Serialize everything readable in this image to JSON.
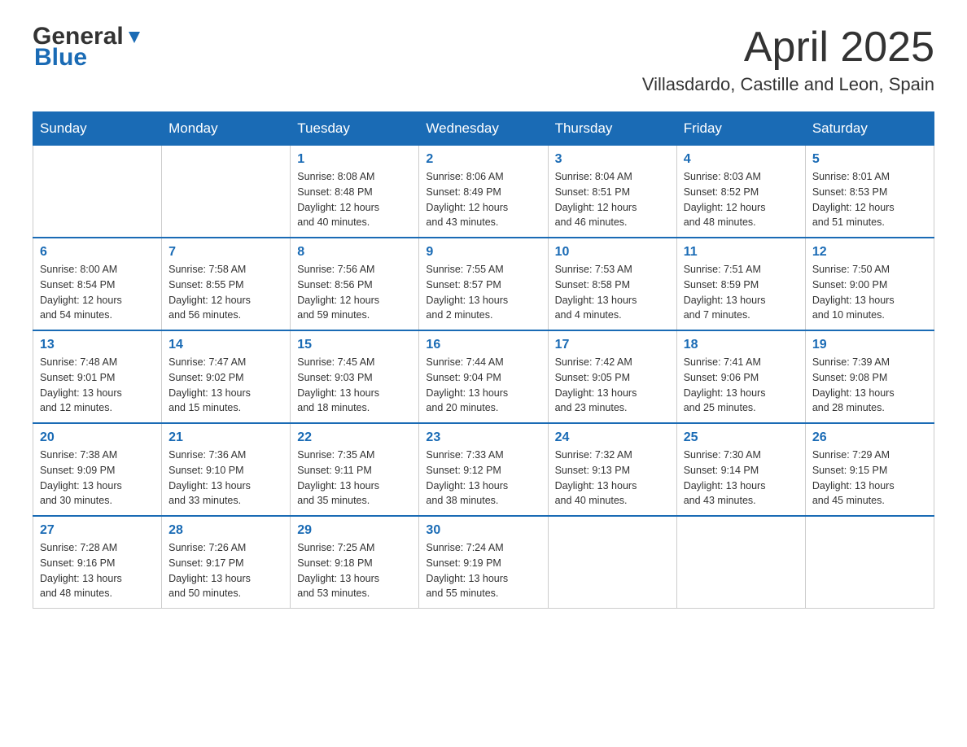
{
  "header": {
    "logo_general": "General",
    "logo_blue": "Blue",
    "month_title": "April 2025",
    "location": "Villasdardo, Castille and Leon, Spain"
  },
  "weekdays": [
    "Sunday",
    "Monday",
    "Tuesday",
    "Wednesday",
    "Thursday",
    "Friday",
    "Saturday"
  ],
  "weeks": [
    [
      {
        "day": "",
        "info": ""
      },
      {
        "day": "",
        "info": ""
      },
      {
        "day": "1",
        "info": "Sunrise: 8:08 AM\nSunset: 8:48 PM\nDaylight: 12 hours\nand 40 minutes."
      },
      {
        "day": "2",
        "info": "Sunrise: 8:06 AM\nSunset: 8:49 PM\nDaylight: 12 hours\nand 43 minutes."
      },
      {
        "day": "3",
        "info": "Sunrise: 8:04 AM\nSunset: 8:51 PM\nDaylight: 12 hours\nand 46 minutes."
      },
      {
        "day": "4",
        "info": "Sunrise: 8:03 AM\nSunset: 8:52 PM\nDaylight: 12 hours\nand 48 minutes."
      },
      {
        "day": "5",
        "info": "Sunrise: 8:01 AM\nSunset: 8:53 PM\nDaylight: 12 hours\nand 51 minutes."
      }
    ],
    [
      {
        "day": "6",
        "info": "Sunrise: 8:00 AM\nSunset: 8:54 PM\nDaylight: 12 hours\nand 54 minutes."
      },
      {
        "day": "7",
        "info": "Sunrise: 7:58 AM\nSunset: 8:55 PM\nDaylight: 12 hours\nand 56 minutes."
      },
      {
        "day": "8",
        "info": "Sunrise: 7:56 AM\nSunset: 8:56 PM\nDaylight: 12 hours\nand 59 minutes."
      },
      {
        "day": "9",
        "info": "Sunrise: 7:55 AM\nSunset: 8:57 PM\nDaylight: 13 hours\nand 2 minutes."
      },
      {
        "day": "10",
        "info": "Sunrise: 7:53 AM\nSunset: 8:58 PM\nDaylight: 13 hours\nand 4 minutes."
      },
      {
        "day": "11",
        "info": "Sunrise: 7:51 AM\nSunset: 8:59 PM\nDaylight: 13 hours\nand 7 minutes."
      },
      {
        "day": "12",
        "info": "Sunrise: 7:50 AM\nSunset: 9:00 PM\nDaylight: 13 hours\nand 10 minutes."
      }
    ],
    [
      {
        "day": "13",
        "info": "Sunrise: 7:48 AM\nSunset: 9:01 PM\nDaylight: 13 hours\nand 12 minutes."
      },
      {
        "day": "14",
        "info": "Sunrise: 7:47 AM\nSunset: 9:02 PM\nDaylight: 13 hours\nand 15 minutes."
      },
      {
        "day": "15",
        "info": "Sunrise: 7:45 AM\nSunset: 9:03 PM\nDaylight: 13 hours\nand 18 minutes."
      },
      {
        "day": "16",
        "info": "Sunrise: 7:44 AM\nSunset: 9:04 PM\nDaylight: 13 hours\nand 20 minutes."
      },
      {
        "day": "17",
        "info": "Sunrise: 7:42 AM\nSunset: 9:05 PM\nDaylight: 13 hours\nand 23 minutes."
      },
      {
        "day": "18",
        "info": "Sunrise: 7:41 AM\nSunset: 9:06 PM\nDaylight: 13 hours\nand 25 minutes."
      },
      {
        "day": "19",
        "info": "Sunrise: 7:39 AM\nSunset: 9:08 PM\nDaylight: 13 hours\nand 28 minutes."
      }
    ],
    [
      {
        "day": "20",
        "info": "Sunrise: 7:38 AM\nSunset: 9:09 PM\nDaylight: 13 hours\nand 30 minutes."
      },
      {
        "day": "21",
        "info": "Sunrise: 7:36 AM\nSunset: 9:10 PM\nDaylight: 13 hours\nand 33 minutes."
      },
      {
        "day": "22",
        "info": "Sunrise: 7:35 AM\nSunset: 9:11 PM\nDaylight: 13 hours\nand 35 minutes."
      },
      {
        "day": "23",
        "info": "Sunrise: 7:33 AM\nSunset: 9:12 PM\nDaylight: 13 hours\nand 38 minutes."
      },
      {
        "day": "24",
        "info": "Sunrise: 7:32 AM\nSunset: 9:13 PM\nDaylight: 13 hours\nand 40 minutes."
      },
      {
        "day": "25",
        "info": "Sunrise: 7:30 AM\nSunset: 9:14 PM\nDaylight: 13 hours\nand 43 minutes."
      },
      {
        "day": "26",
        "info": "Sunrise: 7:29 AM\nSunset: 9:15 PM\nDaylight: 13 hours\nand 45 minutes."
      }
    ],
    [
      {
        "day": "27",
        "info": "Sunrise: 7:28 AM\nSunset: 9:16 PM\nDaylight: 13 hours\nand 48 minutes."
      },
      {
        "day": "28",
        "info": "Sunrise: 7:26 AM\nSunset: 9:17 PM\nDaylight: 13 hours\nand 50 minutes."
      },
      {
        "day": "29",
        "info": "Sunrise: 7:25 AM\nSunset: 9:18 PM\nDaylight: 13 hours\nand 53 minutes."
      },
      {
        "day": "30",
        "info": "Sunrise: 7:24 AM\nSunset: 9:19 PM\nDaylight: 13 hours\nand 55 minutes."
      },
      {
        "day": "",
        "info": ""
      },
      {
        "day": "",
        "info": ""
      },
      {
        "day": "",
        "info": ""
      }
    ]
  ]
}
